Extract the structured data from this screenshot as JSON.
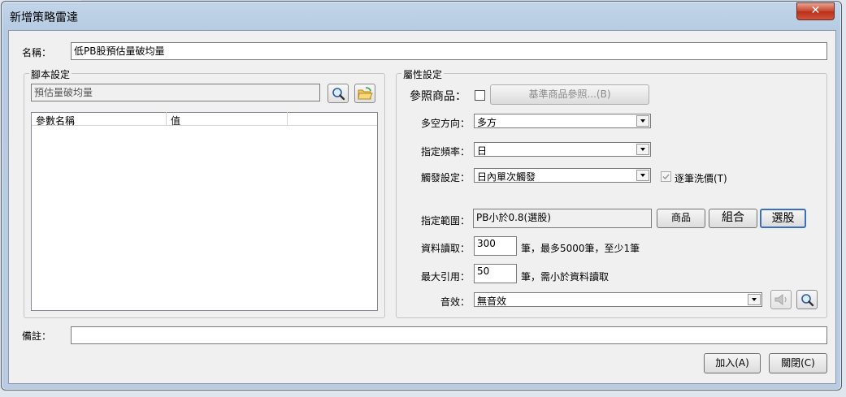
{
  "window": {
    "title": "新增策略雷達",
    "close_glyph": "✕"
  },
  "name_row": {
    "label": "名稱：",
    "value": "低PB股預估量破均量"
  },
  "script_group": {
    "title": "腳本設定",
    "script_value": "預估量破均量",
    "columns": [
      "參數名稱",
      "值"
    ]
  },
  "attr_group": {
    "title": "屬性設定",
    "ref_label": "參照商品：",
    "ref_button": "基準商品參照...(B)",
    "direction_label": "多空方向：",
    "direction_value": "多方",
    "freq_label": "指定頻率：",
    "freq_value": "日",
    "trigger_label": "觸發設定：",
    "trigger_value": "日內單次觸發",
    "tick_label": "逐筆洗價(T)",
    "range_label": "指定範圍：",
    "range_value": "PB小於0.8(選股)",
    "range_buttons": [
      "商品",
      "組合",
      "選股"
    ],
    "read_label": "資料讀取：",
    "read_value": "300",
    "read_note": "筆，最多5000筆，至少1筆",
    "maxref_label": "最大引用：",
    "maxref_value": "50",
    "maxref_note": "筆，需小於資料讀取",
    "sound_label": "音效：",
    "sound_value": "無音效"
  },
  "note_row": {
    "label": "備註：",
    "value": ""
  },
  "footer": {
    "add_button": "加入(A)",
    "close_button": "關閉(C)"
  }
}
